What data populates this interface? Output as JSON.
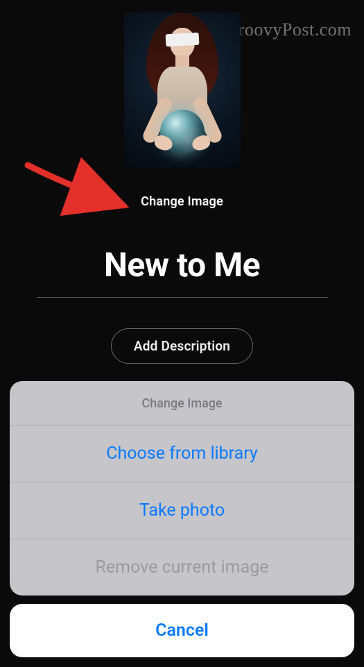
{
  "watermark": "groovyPost.com",
  "editor": {
    "change_image_label": "Change Image",
    "title_value": "New to Me",
    "add_description_label": "Add Description"
  },
  "action_sheet": {
    "title": "Change Image",
    "options": [
      {
        "label": "Choose from library",
        "enabled": true
      },
      {
        "label": "Take photo",
        "enabled": true
      },
      {
        "label": "Remove current image",
        "enabled": false
      }
    ],
    "cancel_label": "Cancel"
  },
  "colors": {
    "ios_blue": "#0a7aff",
    "sheet_bg": "#cdced2",
    "disabled_text": "#9a9a9f"
  }
}
